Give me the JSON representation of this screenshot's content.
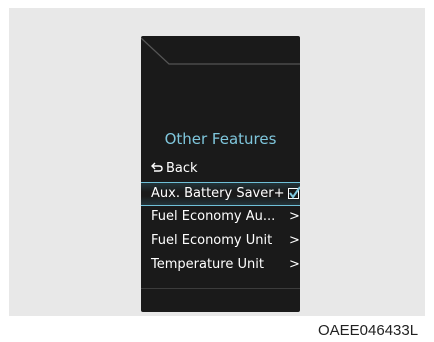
{
  "screen": {
    "title": "Other Features",
    "back_label": "Back",
    "items": [
      {
        "label": "Aux. Battery Saver+",
        "control": "checkbox",
        "checked": true,
        "selected": true
      },
      {
        "label": "Fuel Economy Au...",
        "control": "chevron",
        "selected": false
      },
      {
        "label": "Fuel Economy Unit",
        "control": "chevron",
        "selected": false
      },
      {
        "label": "Temperature Unit",
        "control": "chevron",
        "selected": false
      }
    ],
    "chevron_glyph": ">",
    "back_glyph": "⮌"
  },
  "caption": "OAEE046433L",
  "colors": {
    "accent": "#7fc6dc",
    "screen_bg": "#1a1a1a",
    "panel_bg": "#e8e8e8"
  }
}
